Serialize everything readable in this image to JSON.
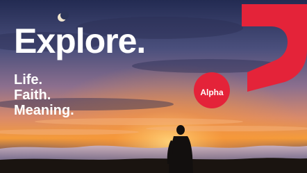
{
  "banner": {
    "headline": "Explore.",
    "taglines": [
      "Life.",
      "Faith.",
      "Meaning."
    ],
    "logo_text": "Alpha"
  },
  "colors": {
    "brand_red": "#e42339",
    "sky_top": "#262f5a",
    "sky_mid": "#6a5a8a",
    "horizon_glow": "#f28a2e",
    "ground": "#1a1410"
  },
  "icons": [
    "crescent-moon-icon",
    "alpha-question-mark-logo",
    "hiker-silhouette"
  ]
}
